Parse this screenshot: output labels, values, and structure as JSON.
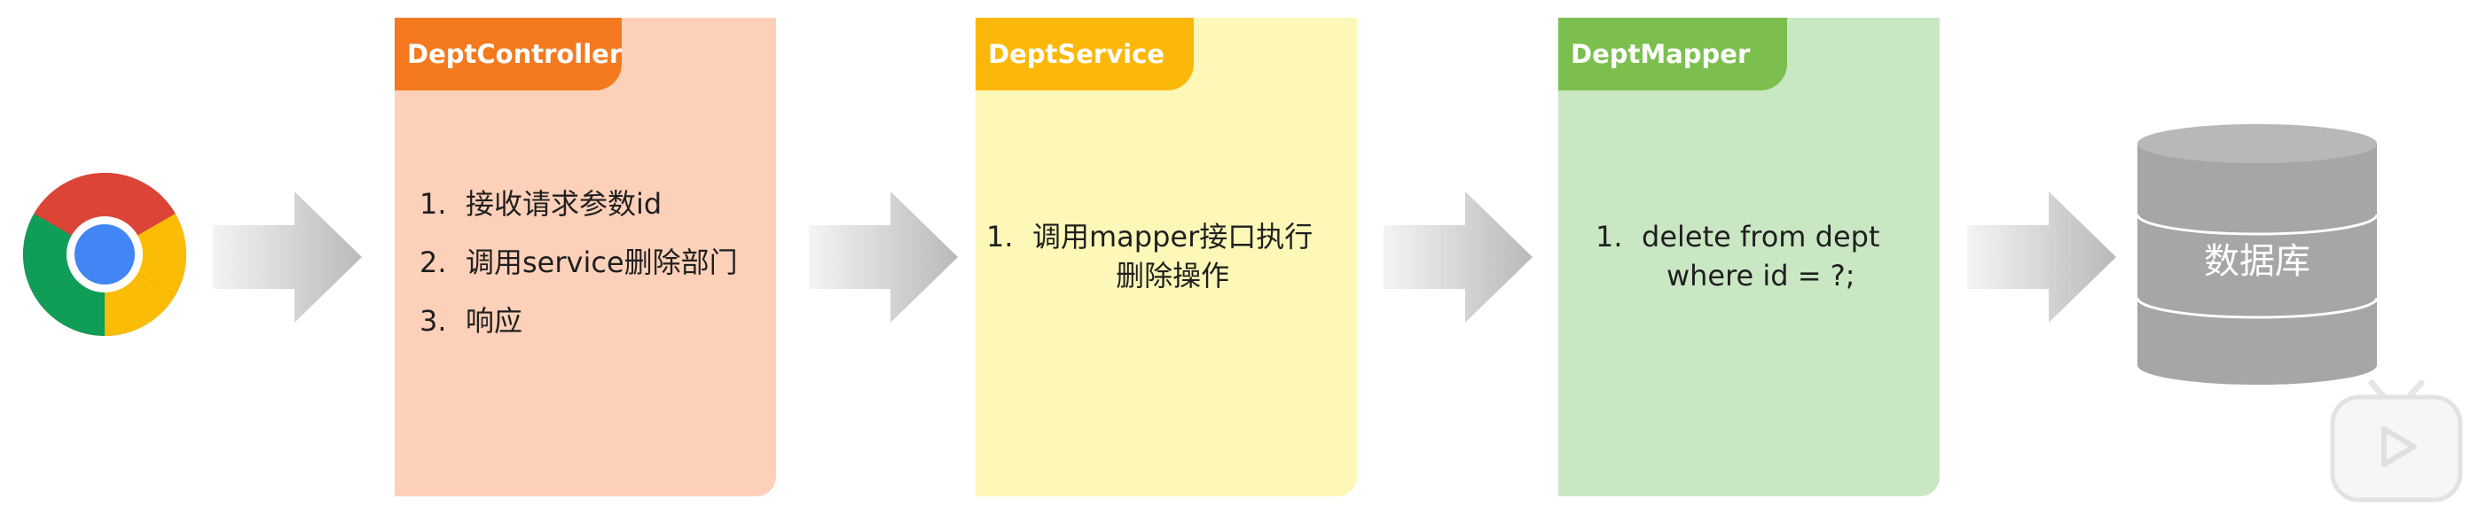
{
  "flow": {
    "client_icon": "chrome-browser-icon",
    "arrow_icon": "right-arrow-icon",
    "layers": [
      {
        "title": "DeptController",
        "accent": "#f4791f",
        "background": "#fdd0b9",
        "items": [
          {
            "num": "1.",
            "text": "接收请求参数id"
          },
          {
            "num": "2.",
            "text": "调用service删除部门"
          },
          {
            "num": "3.",
            "text": "响应"
          }
        ]
      },
      {
        "title": "DeptService",
        "accent": "#fbb70a",
        "background": "#fef8b8",
        "items": [
          {
            "num": "1.",
            "text": "调用mapper接口执行",
            "cont": "删除操作"
          }
        ]
      },
      {
        "title": "DeptMapper",
        "accent": "#7cbf4f",
        "background": "#c9e7c3",
        "items": [
          {
            "num": "1.",
            "text": "delete from dept",
            "cont": "where id = ?;"
          }
        ]
      }
    ],
    "database": {
      "label": "数据库",
      "icon": "database-icon",
      "color": "#a6a6a6"
    }
  },
  "overlay": {
    "player_icon": "tv-play-icon"
  }
}
